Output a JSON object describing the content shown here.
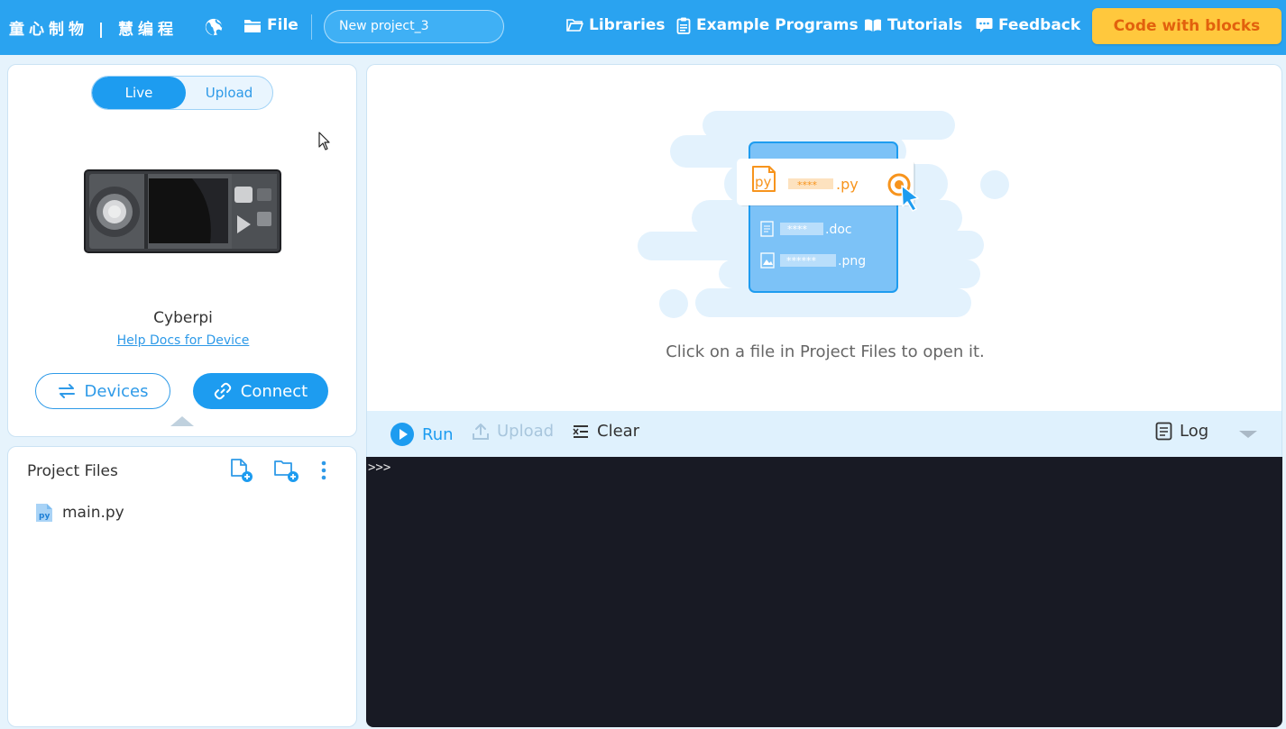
{
  "header": {
    "brand": "童心制物 | 慧编程",
    "globe_icon": "globe-icon",
    "file_label": "File",
    "project_name": "New project_3",
    "nav": {
      "libraries": "Libraries",
      "examples": "Example Programs",
      "tutorials": "Tutorials",
      "feedback": "Feedback"
    },
    "code_with_blocks": "Code with blocks"
  },
  "device": {
    "mode_live": "Live",
    "mode_upload": "Upload",
    "active_mode": "Live",
    "name": "Cyberpi",
    "help_link": "Help Docs for Device",
    "devices_button": "Devices",
    "connect_button": "Connect"
  },
  "files": {
    "title": "Project Files",
    "items": [
      {
        "name": "main.py",
        "icon": "python-file-icon"
      }
    ]
  },
  "editor": {
    "empty_message": "Click on a file in Project Files to open it.",
    "illustration": {
      "file1_mask": "****",
      "file1_ext": ".py",
      "file2_mask": "****",
      "file2_ext": ".doc",
      "file3_mask": "******",
      "file3_ext": ".png"
    }
  },
  "console": {
    "run": "Run",
    "upload": "Upload",
    "clear": "Clear",
    "log": "Log",
    "prompt": ">>>"
  },
  "colors": {
    "header": "#2aa3f0",
    "accent": "#1d9cf0",
    "blocks_button": "#ffc83d",
    "blocks_text": "#e2610d",
    "console_bg": "#181a24",
    "page_bg": "#e6f3fc"
  }
}
